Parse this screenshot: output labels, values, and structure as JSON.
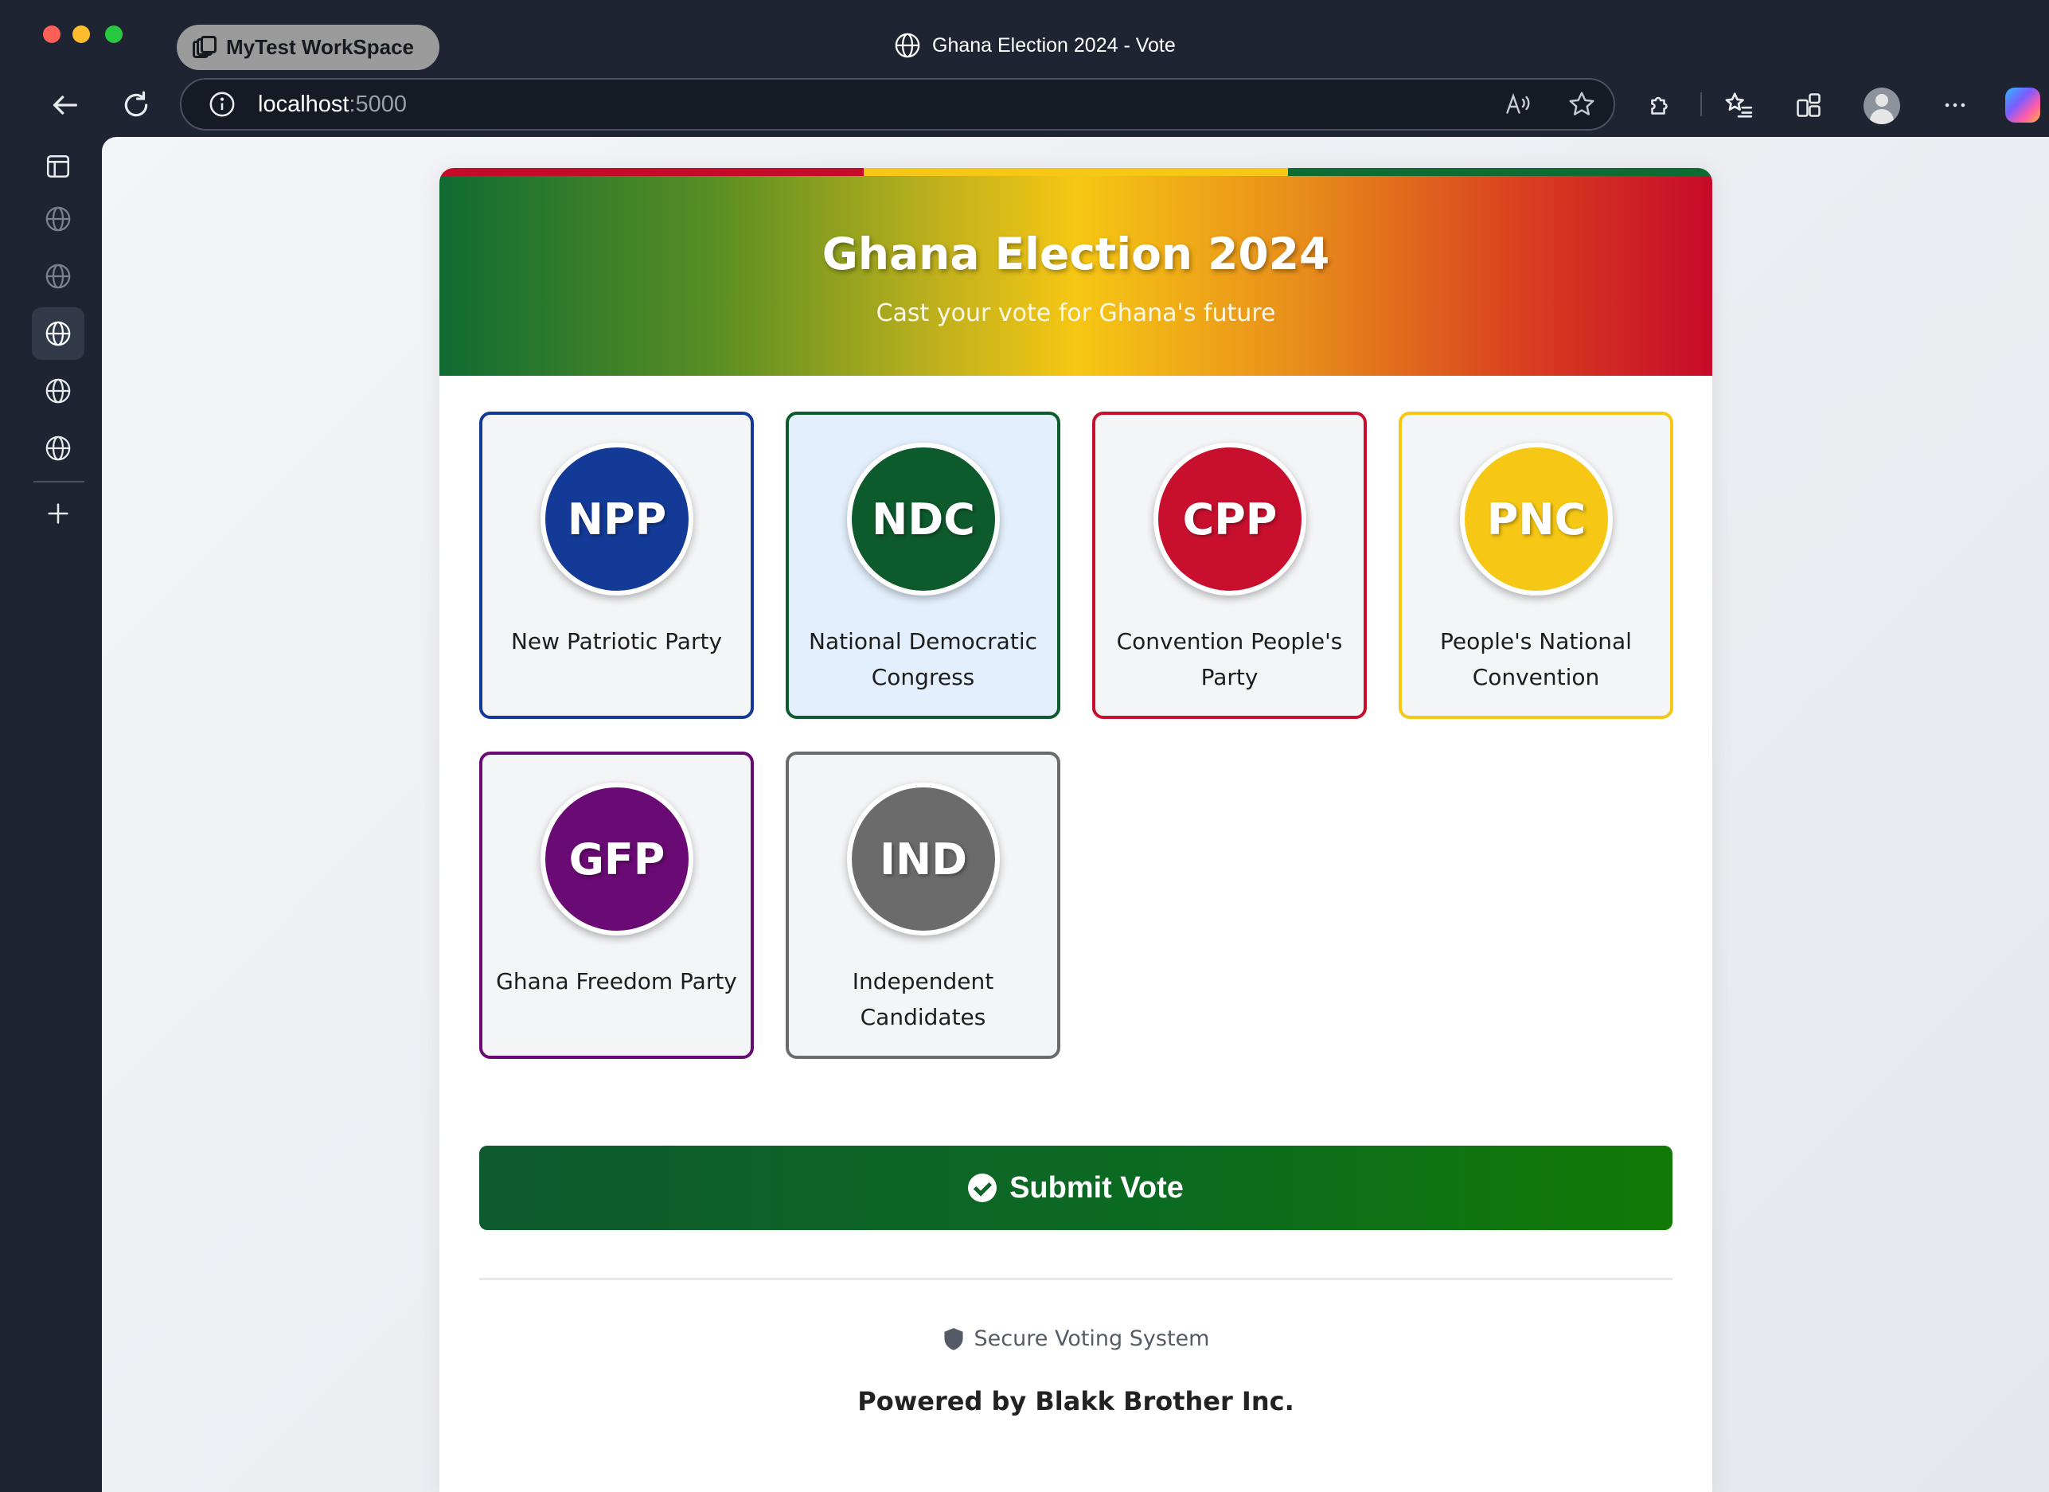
{
  "browser": {
    "workspace_label": "MyTest WorkSpace",
    "tab_title": "Ghana Election 2024 - Vote",
    "url_host": "localhost",
    "url_port": ":5000"
  },
  "header": {
    "title": "Ghana Election 2024",
    "subtitle": "Cast your vote for Ghana's future",
    "flag_colors": [
      "#c60a2a",
      "#f6c714",
      "#0e6b32"
    ]
  },
  "parties": [
    {
      "abbr": "NPP",
      "name": "New Patriotic Party",
      "color": "#133a97",
      "border": "#133a97",
      "selected": false
    },
    {
      "abbr": "NDC",
      "name": "National Democratic Congress",
      "color": "#0d5a2c",
      "border": "#0d5a2c",
      "selected": true
    },
    {
      "abbr": "CPP",
      "name": "Convention People's Party",
      "color": "#c8102e",
      "border": "#c8102e",
      "selected": false
    },
    {
      "abbr": "PNC",
      "name": "People's National Convention",
      "color": "#f6c714",
      "border": "#f6c714",
      "selected": false
    },
    {
      "abbr": "GFP",
      "name": "Ghana Freedom Party",
      "color": "#6a0a74",
      "border": "#6a0a74",
      "selected": false
    },
    {
      "abbr": "IND",
      "name": "Independent Candidates",
      "color": "#6b6b6b",
      "border": "#6b6b6b",
      "selected": false
    }
  ],
  "actions": {
    "submit_label": "Submit Vote"
  },
  "footer": {
    "secure_text": "Secure Voting System",
    "powered_by": "Powered by Blakk Brother Inc."
  }
}
